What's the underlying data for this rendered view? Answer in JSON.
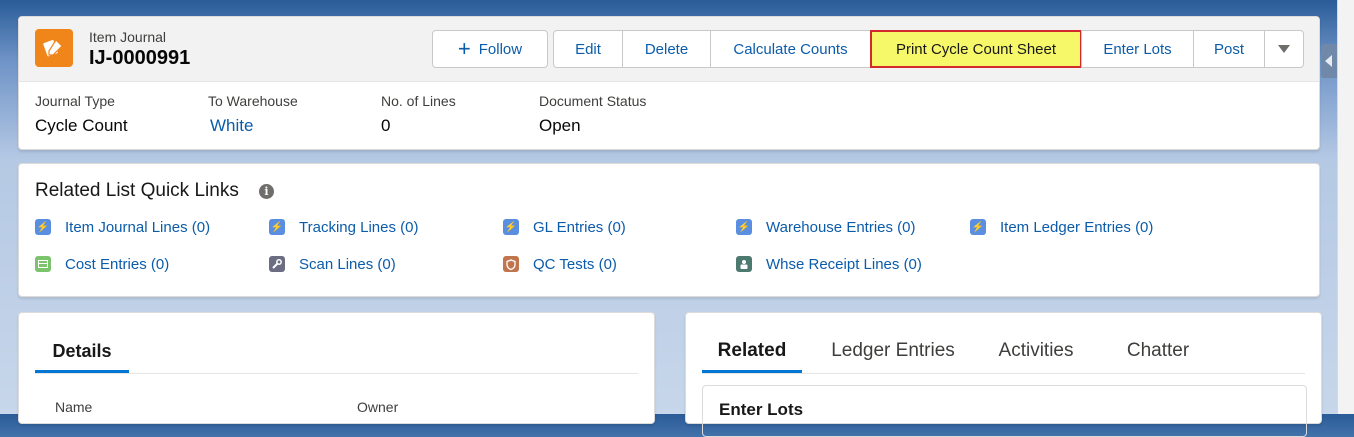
{
  "header": {
    "object_type": "Item Journal",
    "record_name": "IJ-0000991",
    "icon": "item-journal-icon",
    "buttons": {
      "follow": "Follow",
      "edit": "Edit",
      "delete": "Delete",
      "calculate_counts": "Calculate Counts",
      "print_cycle_count_sheet": "Print Cycle Count Sheet",
      "enter_lots": "Enter Lots",
      "post": "Post"
    },
    "fields": [
      {
        "label": "Journal Type",
        "value": "Cycle Count"
      },
      {
        "label": "To Warehouse",
        "value": "White"
      },
      {
        "label": "No. of Lines",
        "value": "0"
      },
      {
        "label": "Document Status",
        "value": "Open"
      }
    ],
    "colors": {
      "brand_icon": "#f0851a",
      "highlight": "#f6f86a",
      "highlight_border": "#d22a2a",
      "link": "#0b5cab"
    }
  },
  "quick_links": {
    "title": "Related List Quick Links",
    "items": [
      {
        "label": "Item Journal Lines (0)",
        "icon": "bolt-icon",
        "color": "#5a8ee0"
      },
      {
        "label": "Tracking Lines (0)",
        "icon": "bolt-icon",
        "color": "#5a8ee0"
      },
      {
        "label": "GL Entries (0)",
        "icon": "bolt-icon",
        "color": "#5a8ee0"
      },
      {
        "label": "Warehouse Entries (0)",
        "icon": "bolt-icon",
        "color": "#5a8ee0"
      },
      {
        "label": "Item Ledger Entries (0)",
        "icon": "bolt-icon",
        "color": "#5a8ee0"
      },
      {
        "label": "Cost Entries (0)",
        "icon": "table-icon",
        "color": "#7cc36d"
      },
      {
        "label": "Scan Lines (0)",
        "icon": "wrench-icon",
        "color": "#6b6d82"
      },
      {
        "label": "QC Tests (0)",
        "icon": "shield-icon",
        "color": "#c0754d"
      },
      {
        "label": "Whse Receipt Lines (0)",
        "icon": "robot-icon",
        "color": "#4d7a6e"
      }
    ]
  },
  "details": {
    "tab": "Details",
    "fields": [
      "Name",
      "Owner"
    ]
  },
  "related": {
    "tabs": [
      "Related",
      "Ledger Entries",
      "Activities",
      "Chatter"
    ],
    "section_title": "Enter Lots"
  }
}
